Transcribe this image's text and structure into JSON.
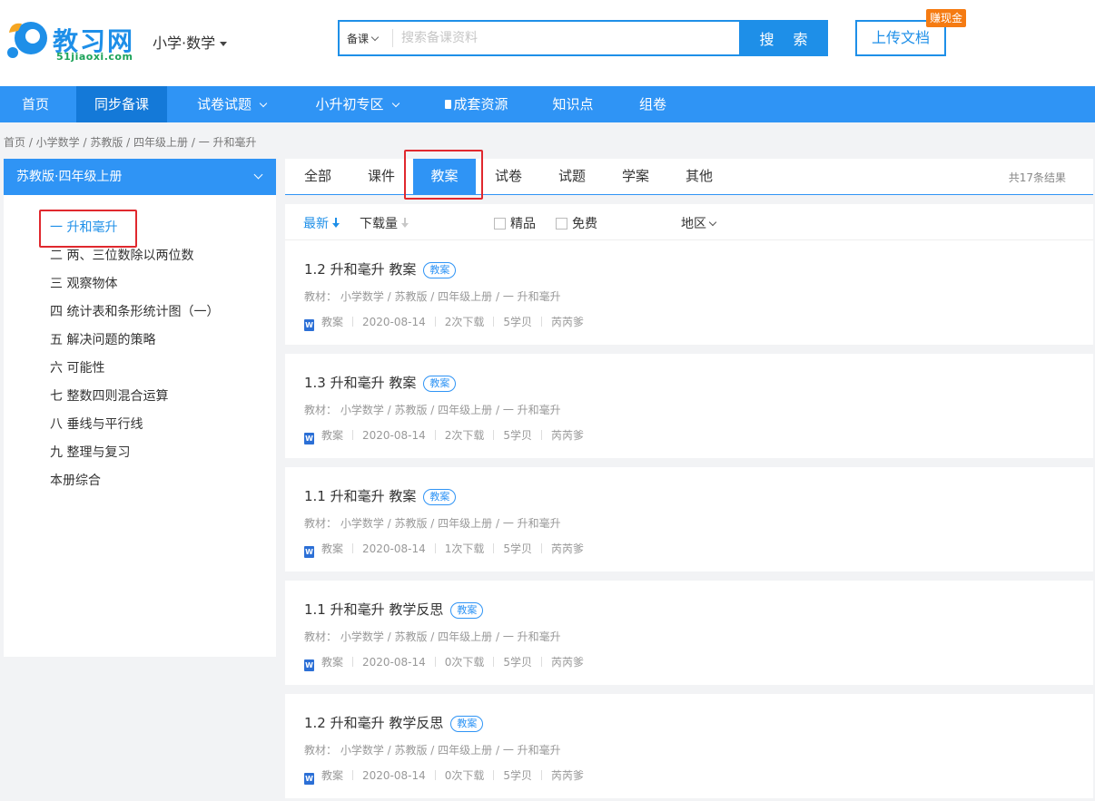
{
  "header": {
    "logo_text": "教习网",
    "logo_domain": "51jiaoxi.com",
    "subject": "小学·数学",
    "search": {
      "type_label": "备课",
      "placeholder": "搜索备课资料",
      "button_label": "搜 索"
    },
    "upload_label": "上传文档",
    "earn_badge": "赚现金"
  },
  "nav": {
    "items": [
      {
        "label": "首页"
      },
      {
        "label": "同步备课",
        "active": true
      },
      {
        "label": "试卷试题"
      },
      {
        "label": "小升初专区"
      },
      {
        "label": "成套资源"
      },
      {
        "label": "知识点"
      },
      {
        "label": "组卷"
      }
    ]
  },
  "breadcrumb": "首页 /  小学数学 / 苏教版 / 四年级上册 / 一 升和毫升",
  "sidebar": {
    "title": "苏教版·四年级上册",
    "items": [
      {
        "label": "一 升和毫升",
        "active": true
      },
      {
        "label": "二 两、三位数除以两位数"
      },
      {
        "label": "三 观察物体"
      },
      {
        "label": "四 统计表和条形统计图（一）"
      },
      {
        "label": "五 解决问题的策略"
      },
      {
        "label": "六 可能性"
      },
      {
        "label": "七 整数四则混合运算"
      },
      {
        "label": "八 垂线与平行线"
      },
      {
        "label": "九 整理与复习"
      },
      {
        "label": "本册综合"
      }
    ]
  },
  "tabs": {
    "items": [
      {
        "label": "全部"
      },
      {
        "label": "课件"
      },
      {
        "label": "教案",
        "active": true
      },
      {
        "label": "试卷"
      },
      {
        "label": "试题"
      },
      {
        "label": "学案"
      },
      {
        "label": "其他"
      }
    ],
    "result_count": "共17条结果"
  },
  "filters": {
    "latest": "最新",
    "downloads": "下载量",
    "premium": "精品",
    "free": "免费",
    "region": "地区"
  },
  "results": [
    {
      "title": "1.2 升和毫升 教案",
      "tag": "教案",
      "path": "教材： 小学数学  / 苏教版  / 四年级上册  / 一 升和毫升",
      "type": "教案",
      "date": "2020-08-14",
      "downloads": "2次下载",
      "price": "5学贝",
      "author": "芮芮爹"
    },
    {
      "title": "1.3 升和毫升 教案",
      "tag": "教案",
      "path": "教材： 小学数学  / 苏教版  / 四年级上册  / 一 升和毫升",
      "type": "教案",
      "date": "2020-08-14",
      "downloads": "2次下载",
      "price": "5学贝",
      "author": "芮芮爹"
    },
    {
      "title": "1.1 升和毫升 教案",
      "tag": "教案",
      "path": "教材： 小学数学  / 苏教版  / 四年级上册  / 一 升和毫升",
      "type": "教案",
      "date": "2020-08-14",
      "downloads": "1次下载",
      "price": "5学贝",
      "author": "芮芮爹"
    },
    {
      "title": "1.1 升和毫升 教学反思",
      "tag": "教案",
      "path": "教材： 小学数学  / 苏教版  / 四年级上册  / 一 升和毫升",
      "type": "教案",
      "date": "2020-08-14",
      "downloads": "0次下载",
      "price": "5学贝",
      "author": "芮芮爹"
    },
    {
      "title": "1.2 升和毫升 教学反思",
      "tag": "教案",
      "path": "教材： 小学数学  / 苏教版  / 四年级上册  / 一 升和毫升",
      "type": "教案",
      "date": "2020-08-14",
      "downloads": "0次下载",
      "price": "5学贝",
      "author": "芮芮爹"
    }
  ],
  "colors": {
    "brand_blue": "#2f94f5",
    "highlight_red": "#e0282e",
    "badge_orange": "#f57b12"
  }
}
